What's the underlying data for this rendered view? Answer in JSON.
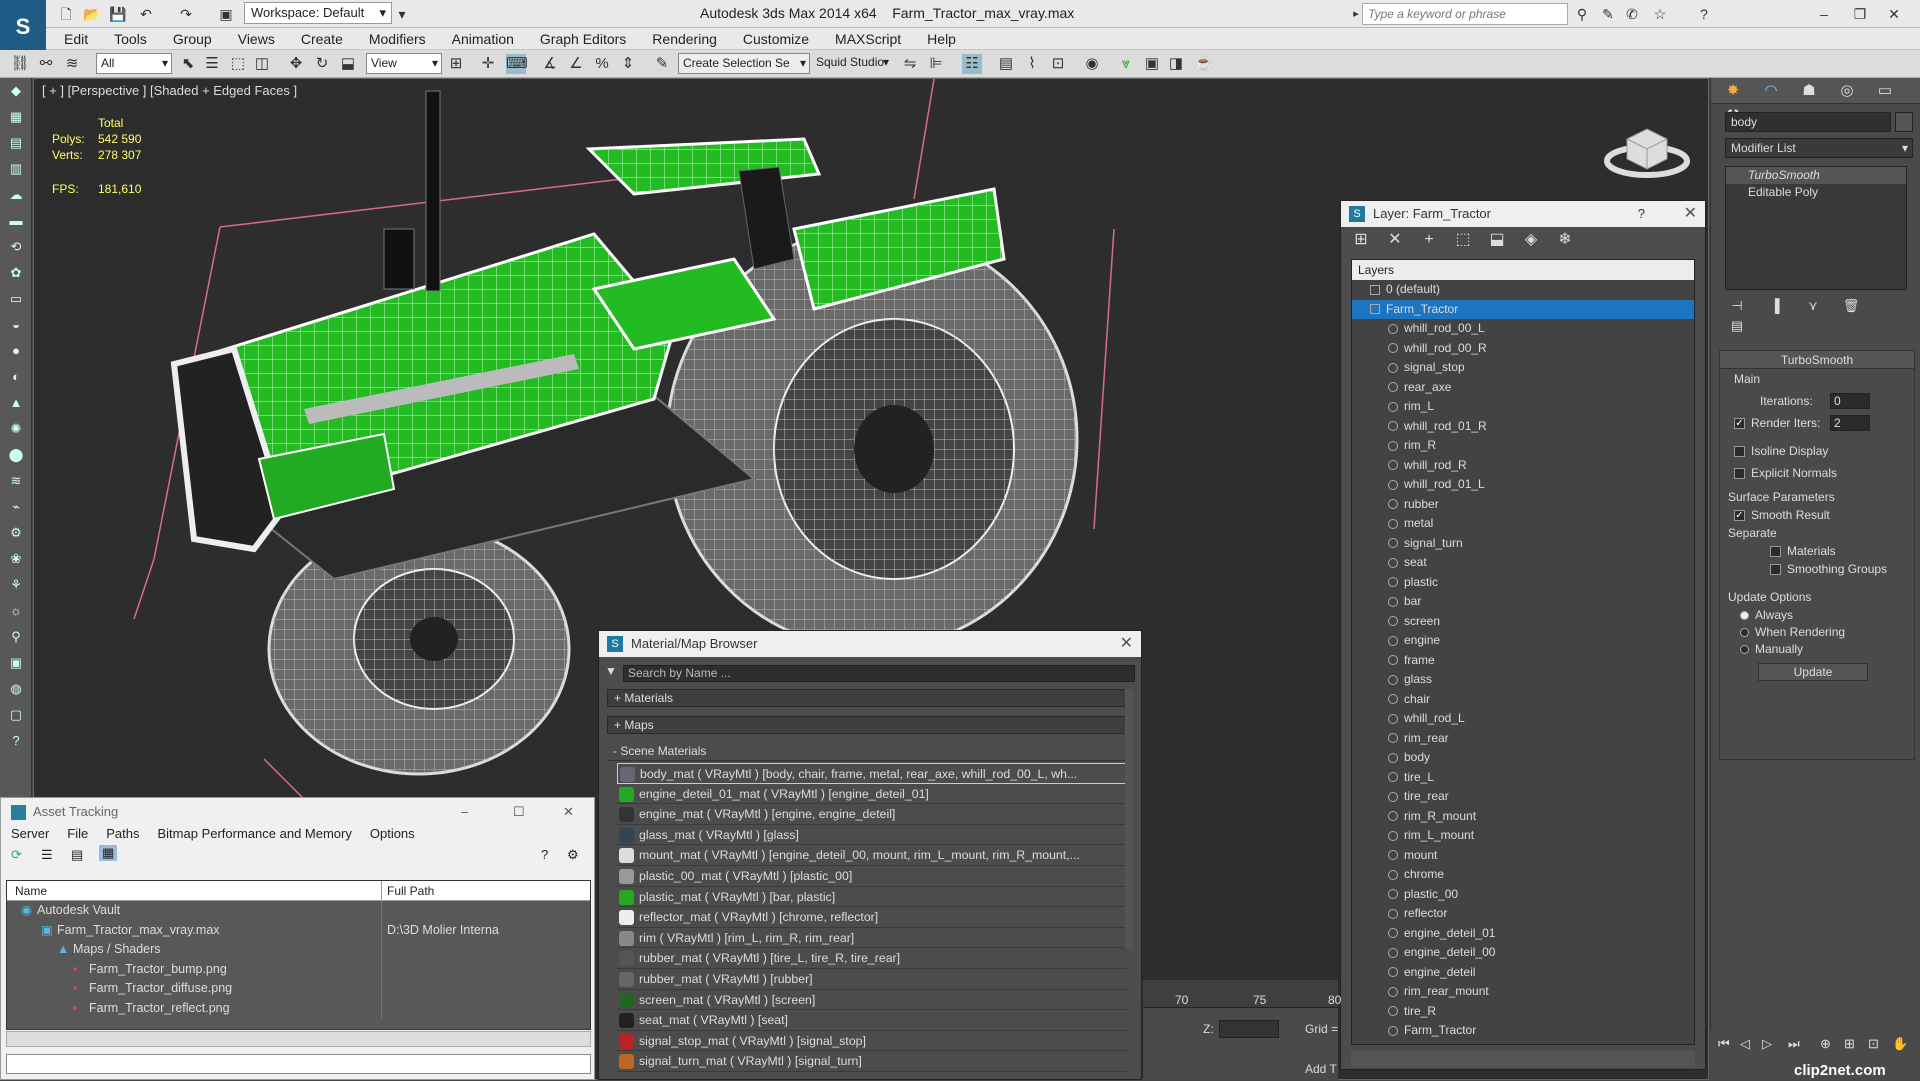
{
  "titlebar": {
    "workspace": "Workspace: Default",
    "app_name": "Autodesk 3ds Max  2014 x64",
    "file_name": "Farm_Tractor_max_vray.max",
    "search_placeholder": "Type a keyword or phrase"
  },
  "menu": [
    "Edit",
    "Tools",
    "Group",
    "Views",
    "Create",
    "Modifiers",
    "Animation",
    "Graph Editors",
    "Rendering",
    "Customize",
    "MAXScript",
    "Help"
  ],
  "toolbar": {
    "filter": "All",
    "ref_coord": "View",
    "selection_set": "Create Selection Se",
    "squid": "Squid Studio v"
  },
  "viewport": {
    "label": "[ + ] [Perspective ] [Shaded + Edged Faces ]",
    "stats_header": "Total",
    "polys_label": "Polys:",
    "polys": "542 590",
    "verts_label": "Verts:",
    "verts": "278 307",
    "fps_label": "FPS:",
    "fps": "181,610"
  },
  "command_panel": {
    "object_name": "body",
    "modifier_list": "Modifier List",
    "stack": [
      "TurboSmooth",
      "Editable Poly"
    ],
    "turbosmooth": {
      "title": "TurboSmooth",
      "main": "Main",
      "iterations_label": "Iterations:",
      "iterations": "0",
      "render_iters_label": "Render Iters:",
      "render_iters": "2",
      "isoline": "Isoline Display",
      "explicit": "Explicit Normals",
      "surface": "Surface Parameters",
      "smooth_result": "Smooth Result",
      "separate": "Separate",
      "materials": "Materials",
      "smoothing_groups": "Smoothing Groups",
      "update_options": "Update Options",
      "always": "Always",
      "when_rendering": "When Rendering",
      "manually": "Manually",
      "update": "Update"
    }
  },
  "layer_dialog": {
    "title": "Layer: Farm_Tractor",
    "help": "?",
    "header": "Layers",
    "default_layer": "0 (default)",
    "active_layer": "Farm_Tractor",
    "objects": [
      "whill_rod_00_L",
      "whill_rod_00_R",
      "signal_stop",
      "rear_axe",
      "rim_L",
      "whill_rod_01_R",
      "rim_R",
      "whill_rod_R",
      "whill_rod_01_L",
      "rubber",
      "metal",
      "signal_turn",
      "seat",
      "plastic",
      "bar",
      "screen",
      "engine",
      "frame",
      "glass",
      "chair",
      "whill_rod_L",
      "rim_rear",
      "body",
      "tire_L",
      "tire_rear",
      "rim_R_mount",
      "rim_L_mount",
      "mount",
      "chrome",
      "plastic_00",
      "reflector",
      "engine_deteil_01",
      "engine_deteil_00",
      "engine_deteil",
      "rim_rear_mount",
      "tire_R",
      "Farm_Tractor"
    ]
  },
  "material_browser": {
    "title": "Material/Map Browser",
    "search": "Search by Name ...",
    "sections": [
      "+ Materials",
      "+ Maps",
      "- Scene Materials"
    ],
    "materials": [
      "body_mat  ( VRayMtl )  [body, chair, frame, metal, rear_axe, whill_rod_00_L, wh...",
      "engine_deteil_01_mat  ( VRayMtl )  [engine_deteil_01]",
      "engine_mat  ( VRayMtl )  [engine, engine_deteil]",
      "glass_mat  ( VRayMtl )  [glass]",
      "mount_mat  ( VRayMtl )  [engine_deteil_00, mount, rim_L_mount, rim_R_mount,...",
      "plastic_00_mat  ( VRayMtl )  [plastic_00]",
      "plastic_mat  ( VRayMtl )  [bar, plastic]",
      "reflector_mat  ( VRayMtl )  [chrome, reflector]",
      "rim  ( VRayMtl )  [rim_L, rim_R, rim_rear]",
      "rubber_mat  ( VRayMtl )  [tire_L, tire_R, tire_rear]",
      "rubber_mat  ( VRayMtl )  [rubber]",
      "screen_mat  ( VRayMtl )  [screen]",
      "seat_mat  ( VRayMtl )  [seat]",
      "signal_stop_mat  ( VRayMtl )  [signal_stop]",
      "signal_turn_mat  ( VRayMtl )  [signal_turn]"
    ]
  },
  "asset_tracking": {
    "title": "Asset Tracking",
    "menu": [
      "Server",
      "File",
      "Paths",
      "Bitmap Performance and Memory",
      "Options"
    ],
    "col_name": "Name",
    "col_path": "Full Path",
    "rows": [
      {
        "name": "Autodesk Vault",
        "path": ""
      },
      {
        "name": "Farm_Tractor_max_vray.max",
        "path": "D:\\3D Molier Interna"
      },
      {
        "name": "Maps / Shaders",
        "path": ""
      },
      {
        "name": "Farm_Tractor_bump.png",
        "path": ""
      },
      {
        "name": "Farm_Tractor_diffuse.png",
        "path": ""
      },
      {
        "name": "Farm_Tractor_reflect.png",
        "path": ""
      }
    ]
  },
  "timeline": {
    "ticks": [
      "70",
      "75",
      "80"
    ],
    "z_label": "Z:",
    "grid": "Grid =",
    "add_t": "Add T"
  },
  "watermark": "clip2net.com"
}
